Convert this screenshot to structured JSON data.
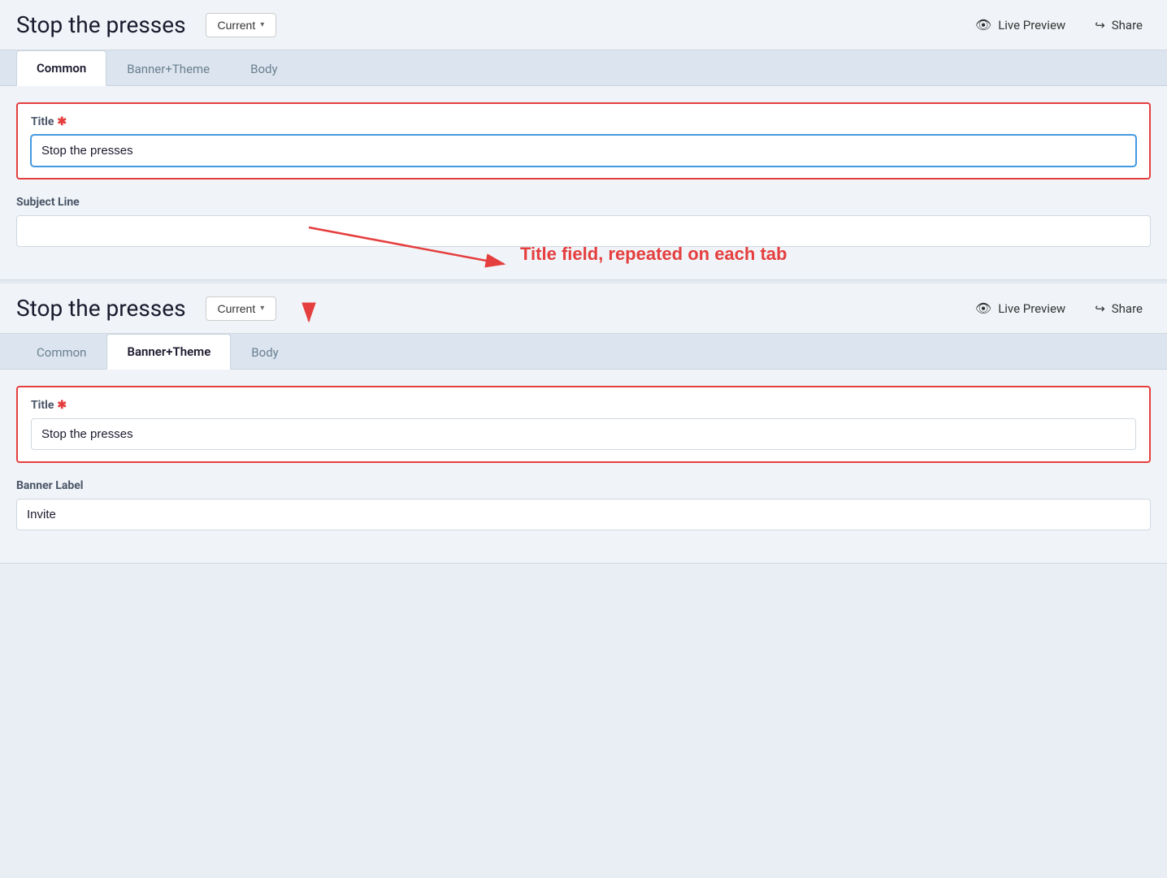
{
  "page": {
    "title": "Stop the presses"
  },
  "panel1": {
    "title": "Stop the presses",
    "dropdown_label": "Current",
    "live_preview_label": "Live Preview",
    "share_label": "Share",
    "tabs": [
      {
        "id": "common",
        "label": "Common",
        "active": true
      },
      {
        "id": "banner-theme",
        "label": "Banner+Theme",
        "active": false
      },
      {
        "id": "body",
        "label": "Body",
        "active": false
      }
    ],
    "title_field": {
      "label": "Title",
      "required": true,
      "value": "Stop the presses",
      "placeholder": ""
    },
    "subject_line_field": {
      "label": "Subject Line",
      "required": false,
      "value": "",
      "placeholder": ""
    }
  },
  "annotation": {
    "label": "Title field, repeated on each tab"
  },
  "panel2": {
    "title": "Stop the presses",
    "dropdown_label": "Current",
    "live_preview_label": "Live Preview",
    "share_label": "Share",
    "tabs": [
      {
        "id": "common",
        "label": "Common",
        "active": false
      },
      {
        "id": "banner-theme",
        "label": "Banner+Theme",
        "active": true
      },
      {
        "id": "body",
        "label": "Body",
        "active": false
      }
    ],
    "title_field": {
      "label": "Title",
      "required": true,
      "value": "Stop the presses",
      "placeholder": ""
    },
    "banner_label_field": {
      "label": "Banner Label",
      "required": false,
      "value": "Invite",
      "placeholder": ""
    }
  }
}
